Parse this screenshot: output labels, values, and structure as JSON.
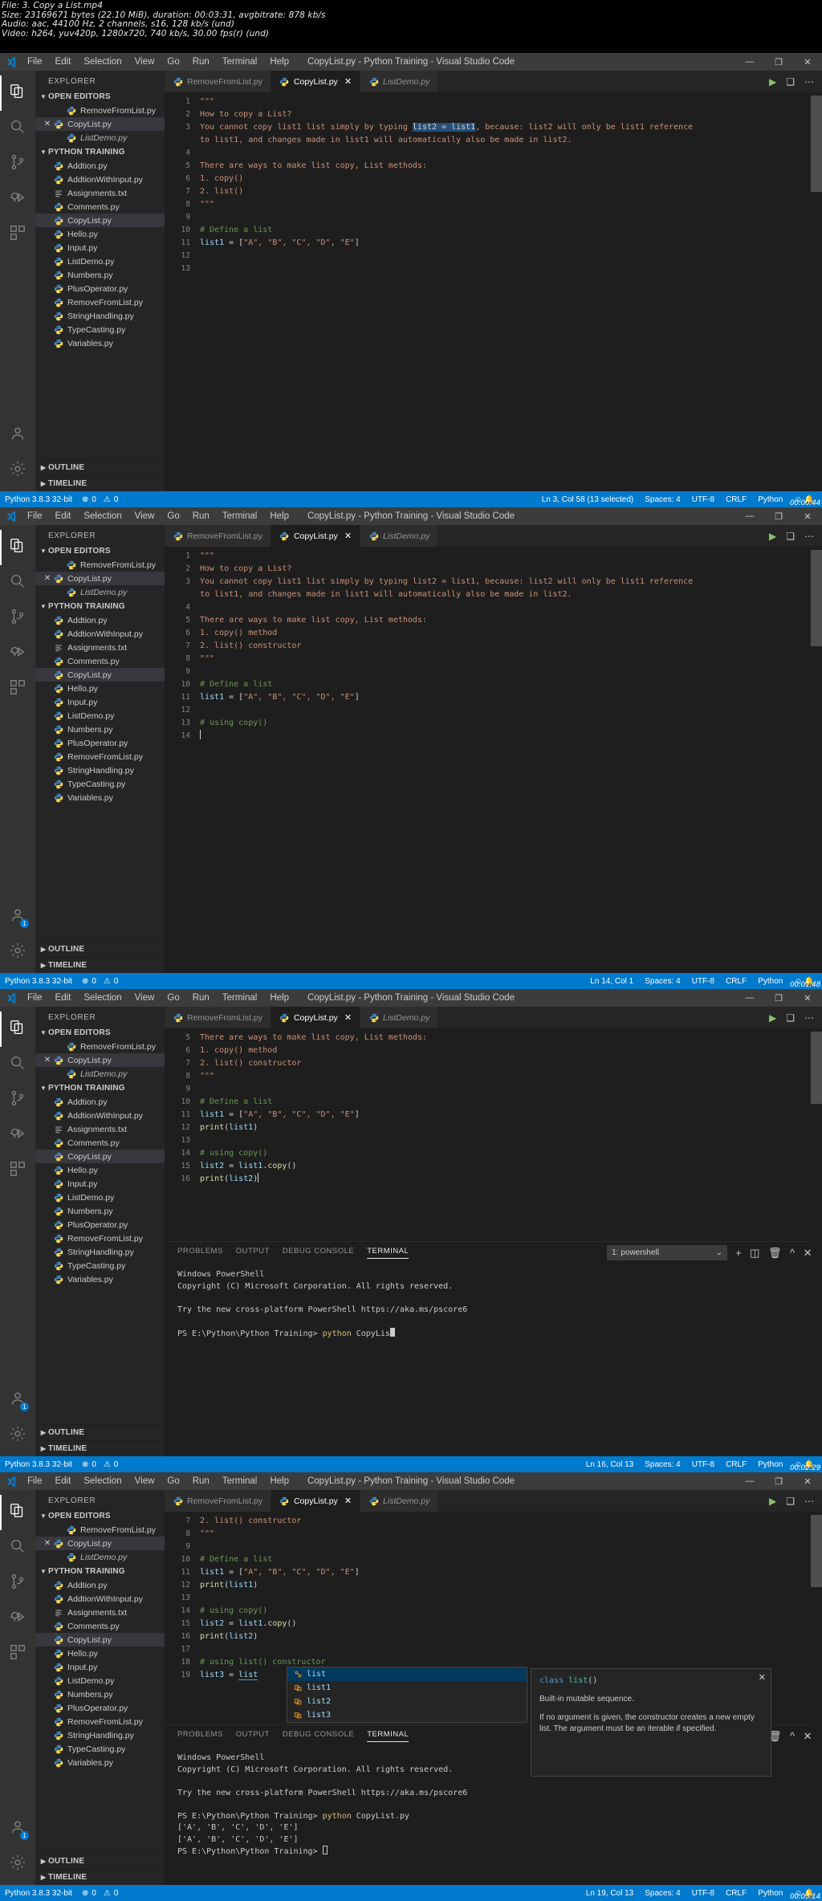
{
  "meta": {
    "lines": [
      "File: 3. Copy a List.mp4",
      "Size: 23169671 bytes (22.10 MiB), duration: 00:03:31, avgbitrate: 878 kb/s",
      "Audio: aac, 44100 Hz, 2 channels, s16, 128 kb/s (und)",
      "Video: h264, yuv420p, 1280x720, 740 kb/s, 30.00 fps(r) (und)"
    ]
  },
  "menu": [
    "File",
    "Edit",
    "Selection",
    "View",
    "Go",
    "Run",
    "Terminal",
    "Help"
  ],
  "window_title": "CopyList.py - Python Training - Visual Studio Code",
  "window_controls": [
    "—",
    "❐",
    "✕"
  ],
  "activity_bar": [
    {
      "name": "explorer",
      "label": "Explorer"
    },
    {
      "name": "search",
      "label": "Search"
    },
    {
      "name": "source-control",
      "label": "Source Control"
    },
    {
      "name": "run-debug",
      "label": "Run and Debug"
    },
    {
      "name": "extensions",
      "label": "Extensions"
    }
  ],
  "sidebar": {
    "title": "EXPLORER",
    "open_editors_label": "OPEN EDITORS",
    "open_editors": [
      {
        "label": "RemoveFromList.py",
        "state": "normal"
      },
      {
        "label": "CopyList.py",
        "state": "active"
      },
      {
        "label": "ListDemo.py",
        "state": "preview"
      }
    ],
    "project_label": "PYTHON TRAINING",
    "files": [
      "Addtion.py",
      "AddtionWithInput.py",
      "Assignments.txt",
      "Comments.py",
      "CopyList.py",
      "Hello.py",
      "Input.py",
      "ListDemo.py",
      "Numbers.py",
      "PlusOperator.py",
      "RemoveFromList.py",
      "StringHandling.py",
      "TypeCasting.py",
      "Variables.py"
    ],
    "selected_file": "CopyList.py",
    "outline_label": "OUTLINE",
    "timeline_label": "TIMELINE"
  },
  "tabs": [
    {
      "label": "RemoveFromList.py",
      "active": false,
      "preview": false
    },
    {
      "label": "CopyList.py",
      "active": true,
      "preview": false,
      "close": "✕"
    },
    {
      "label": "ListDemo.py",
      "active": false,
      "preview": true
    }
  ],
  "editor_actions": {
    "run": "▶",
    "split": "❑",
    "more": "⋯"
  },
  "panel": {
    "tabs": [
      "PROBLEMS",
      "OUTPUT",
      "DEBUG CONSOLE",
      "TERMINAL"
    ],
    "active_tab": "TERMINAL",
    "terminal_select": "1: powershell",
    "select_caret": "⌄",
    "actions": [
      "+",
      "◫",
      "Ὕ1",
      "^",
      "✕"
    ]
  },
  "windows": [
    {
      "id": "w1",
      "code": [
        {
          "n": "1",
          "segs": [
            {
              "t": "\"\"\"",
              "c": "str"
            }
          ]
        },
        {
          "n": "2",
          "segs": [
            {
              "t": "How to copy a List?",
              "c": "str"
            }
          ]
        },
        {
          "n": "3",
          "segs": [
            {
              "t": "You cannot copy list1 list simply by typing ",
              "c": "str"
            },
            {
              "t": "list2 = list1",
              "c": "sel"
            },
            {
              "t": ", because: list2 will only be list1 reference",
              "c": "str"
            }
          ]
        },
        {
          "n": "",
          "segs": [
            {
              "t": "to list1, and changes made in list1 will automatically also be made in list2.",
              "c": "str"
            }
          ]
        },
        {
          "n": "4",
          "segs": []
        },
        {
          "n": "5",
          "segs": [
            {
              "t": "There are ways to make list copy, List methods:",
              "c": "str"
            }
          ]
        },
        {
          "n": "6",
          "segs": [
            {
              "t": "1. copy()",
              "c": "str"
            }
          ]
        },
        {
          "n": "7",
          "segs": [
            {
              "t": "2. list()",
              "c": "str"
            }
          ]
        },
        {
          "n": "8",
          "segs": [
            {
              "t": "\"\"\"",
              "c": "str"
            }
          ]
        },
        {
          "n": "9",
          "segs": []
        },
        {
          "n": "10",
          "segs": [
            {
              "t": "# Define a list",
              "c": "cmt"
            }
          ]
        },
        {
          "n": "11",
          "segs": [
            {
              "t": "list1 ",
              "c": "var"
            },
            {
              "t": "= ",
              "c": "plain"
            },
            {
              "t": "[",
              "c": "plain"
            },
            {
              "t": "\"A\", \"B\", \"C\", \"D\", \"E\"",
              "c": "str"
            },
            {
              "t": "]",
              "c": "plain"
            }
          ]
        },
        {
          "n": "12",
          "segs": []
        },
        {
          "n": "13",
          "segs": []
        }
      ],
      "status": {
        "python": "Python 3.8.3 32-bit",
        "errors": "0",
        "warnings": "0",
        "position": "Ln 3, Col 58 (13 selected)",
        "spaces": "Spaces: 4",
        "encoding": "UTF-8",
        "eol": "CRLF",
        "language": "Python",
        "timecode": "00:00:44"
      }
    },
    {
      "id": "w2",
      "code": [
        {
          "n": "1",
          "segs": [
            {
              "t": "\"\"\"",
              "c": "str"
            }
          ]
        },
        {
          "n": "2",
          "segs": [
            {
              "t": "How to copy a List?",
              "c": "str"
            }
          ]
        },
        {
          "n": "3",
          "segs": [
            {
              "t": "You cannot copy list1 list simply by typing list2 = list1, because: list2 will only be list1 reference",
              "c": "str"
            }
          ]
        },
        {
          "n": "",
          "segs": [
            {
              "t": "to list1, and changes made in list1 will automatically also be made in list2.",
              "c": "str"
            }
          ]
        },
        {
          "n": "4",
          "segs": []
        },
        {
          "n": "5",
          "segs": [
            {
              "t": "There are ways to make list copy, List methods:",
              "c": "str"
            }
          ]
        },
        {
          "n": "6",
          "segs": [
            {
              "t": "1. copy() method",
              "c": "str"
            }
          ]
        },
        {
          "n": "7",
          "segs": [
            {
              "t": "2. list() constructor",
              "c": "str"
            }
          ]
        },
        {
          "n": "8",
          "segs": [
            {
              "t": "\"\"\"",
              "c": "str"
            }
          ]
        },
        {
          "n": "9",
          "segs": []
        },
        {
          "n": "10",
          "segs": [
            {
              "t": "# Define a list",
              "c": "cmt"
            }
          ]
        },
        {
          "n": "11",
          "segs": [
            {
              "t": "list1 ",
              "c": "var"
            },
            {
              "t": "= ",
              "c": "plain"
            },
            {
              "t": "[",
              "c": "plain"
            },
            {
              "t": "\"A\", \"B\", \"C\", \"D\", \"E\"",
              "c": "str"
            },
            {
              "t": "]",
              "c": "plain"
            }
          ]
        },
        {
          "n": "12",
          "segs": []
        },
        {
          "n": "13",
          "segs": [
            {
              "t": "# using copy()",
              "c": "cmt"
            }
          ]
        },
        {
          "n": "14",
          "segs": [
            {
              "t": "",
              "c": "caret"
            }
          ]
        }
      ],
      "status": {
        "python": "Python 3.8.3 32-bit",
        "errors": "0",
        "warnings": "0",
        "position": "Ln 14, Col 1",
        "spaces": "Spaces: 4",
        "encoding": "UTF-8",
        "eol": "CRLF",
        "language": "Python",
        "timecode": "00:01:48"
      }
    },
    {
      "id": "w3",
      "code": [
        {
          "n": "5",
          "segs": [
            {
              "t": "There are ways to make list copy, List methods:",
              "c": "str"
            }
          ]
        },
        {
          "n": "6",
          "segs": [
            {
              "t": "1. copy() method",
              "c": "str"
            }
          ]
        },
        {
          "n": "7",
          "segs": [
            {
              "t": "2. list() constructor",
              "c": "str"
            }
          ]
        },
        {
          "n": "8",
          "segs": [
            {
              "t": "\"\"\"",
              "c": "str"
            }
          ]
        },
        {
          "n": "9",
          "segs": []
        },
        {
          "n": "10",
          "segs": [
            {
              "t": "# Define a list",
              "c": "cmt"
            }
          ]
        },
        {
          "n": "11",
          "segs": [
            {
              "t": "list1 ",
              "c": "var"
            },
            {
              "t": "= ",
              "c": "plain"
            },
            {
              "t": "[",
              "c": "plain"
            },
            {
              "t": "\"A\", \"B\", \"C\", \"D\", \"E\"",
              "c": "str"
            },
            {
              "t": "]",
              "c": "plain"
            }
          ]
        },
        {
          "n": "12",
          "segs": [
            {
              "t": "print",
              "c": "fn"
            },
            {
              "t": "(",
              "c": "plain"
            },
            {
              "t": "list1",
              "c": "var"
            },
            {
              "t": ")",
              "c": "plain"
            }
          ]
        },
        {
          "n": "13",
          "segs": []
        },
        {
          "n": "14",
          "segs": [
            {
              "t": "# using copy()",
              "c": "cmt"
            }
          ]
        },
        {
          "n": "15",
          "segs": [
            {
              "t": "list2 ",
              "c": "var"
            },
            {
              "t": "= ",
              "c": "plain"
            },
            {
              "t": "list1",
              "c": "var"
            },
            {
              "t": ".",
              "c": "plain"
            },
            {
              "t": "copy",
              "c": "fn"
            },
            {
              "t": "()",
              "c": "plain"
            }
          ]
        },
        {
          "n": "16",
          "segs": [
            {
              "t": "print",
              "c": "fn"
            },
            {
              "t": "(",
              "c": "plain"
            },
            {
              "t": "list2",
              "c": "var"
            },
            {
              "t": ")",
              "c": "caretafter"
            }
          ]
        }
      ],
      "terminal": [
        {
          "segs": [
            {
              "t": "Windows PowerShell",
              "c": "plain"
            }
          ]
        },
        {
          "segs": [
            {
              "t": "Copyright (C) Microsoft Corporation. All rights reserved.",
              "c": "plain"
            }
          ]
        },
        {
          "segs": []
        },
        {
          "segs": [
            {
              "t": "Try the new cross-platform PowerShell https://aka.ms/pscore6",
              "c": "plain"
            }
          ]
        },
        {
          "segs": []
        },
        {
          "segs": [
            {
              "t": "PS E:\\Python\\Python Training> ",
              "c": "plain"
            },
            {
              "t": "python",
              "c": "tyellow"
            },
            {
              "t": " CopyLis",
              "c": "plain"
            },
            {
              "t": "█",
              "c": "block"
            }
          ]
        }
      ],
      "status": {
        "python": "Python 3.8.3 32-bit",
        "errors": "0",
        "warnings": "0",
        "position": "Ln 16, Col 13",
        "spaces": "Spaces: 4",
        "encoding": "UTF-8",
        "eol": "CRLF",
        "language": "Python",
        "timecode": "00:02:29"
      }
    },
    {
      "id": "w4",
      "code": [
        {
          "n": "7",
          "segs": [
            {
              "t": "2. list() constructor",
              "c": "str"
            }
          ]
        },
        {
          "n": "8",
          "segs": [
            {
              "t": "\"\"\"",
              "c": "str"
            }
          ]
        },
        {
          "n": "9",
          "segs": []
        },
        {
          "n": "10",
          "segs": [
            {
              "t": "# Define a list",
              "c": "cmt"
            }
          ]
        },
        {
          "n": "11",
          "segs": [
            {
              "t": "list1 ",
              "c": "var"
            },
            {
              "t": "= ",
              "c": "plain"
            },
            {
              "t": "[",
              "c": "plain"
            },
            {
              "t": "\"A\", \"B\", \"C\", \"D\", \"E\"",
              "c": "str"
            },
            {
              "t": "]",
              "c": "plain"
            }
          ]
        },
        {
          "n": "12",
          "segs": [
            {
              "t": "print",
              "c": "fn"
            },
            {
              "t": "(",
              "c": "plain"
            },
            {
              "t": "list1",
              "c": "var"
            },
            {
              "t": ")",
              "c": "plain"
            }
          ]
        },
        {
          "n": "13",
          "segs": []
        },
        {
          "n": "14",
          "segs": [
            {
              "t": "# using copy()",
              "c": "cmt"
            }
          ]
        },
        {
          "n": "15",
          "segs": [
            {
              "t": "list2 ",
              "c": "var"
            },
            {
              "t": "= ",
              "c": "plain"
            },
            {
              "t": "list1",
              "c": "var"
            },
            {
              "t": ".",
              "c": "plain"
            },
            {
              "t": "copy",
              "c": "fn"
            },
            {
              "t": "()",
              "c": "plain"
            }
          ]
        },
        {
          "n": "16",
          "segs": [
            {
              "t": "print",
              "c": "fn"
            },
            {
              "t": "(",
              "c": "plain"
            },
            {
              "t": "list2",
              "c": "var"
            },
            {
              "t": ")",
              "c": "plain"
            }
          ]
        },
        {
          "n": "17",
          "segs": []
        },
        {
          "n": "18",
          "segs": [
            {
              "t": "# using list() constructor",
              "c": "cmt"
            }
          ]
        },
        {
          "n": "19",
          "segs": [
            {
              "t": "list3 ",
              "c": "var"
            },
            {
              "t": "= ",
              "c": "plain"
            },
            {
              "t": "list",
              "c": "under"
            }
          ]
        }
      ],
      "suggest": {
        "items": [
          {
            "label": "list",
            "kind": "class",
            "selected": true
          },
          {
            "label": "list1",
            "kind": "variable",
            "selected": false
          },
          {
            "label": "list2",
            "kind": "variable",
            "selected": false
          },
          {
            "label": "list3",
            "kind": "variable",
            "selected": false
          }
        ]
      },
      "doc": {
        "signature_kw": "class",
        "signature_name": "list",
        "signature_args": "()",
        "paragraphs": [
          "Built-in mutable sequence.",
          "If no argument is given, the constructor creates a new empty list. The argument must be an iterable if specified."
        ],
        "close": "✕"
      },
      "terminal": [
        {
          "segs": [
            {
              "t": "Windows PowerShell",
              "c": "plain"
            }
          ]
        },
        {
          "segs": [
            {
              "t": "Copyright (C) Microsoft Corporation. All rights reserved.",
              "c": "plain"
            }
          ]
        },
        {
          "segs": []
        },
        {
          "segs": [
            {
              "t": "Try the new cross-platform PowerShell https://aka.ms/pscore6",
              "c": "plain"
            }
          ]
        },
        {
          "segs": []
        },
        {
          "segs": [
            {
              "t": "PS E:\\Python\\Python Training> ",
              "c": "plain"
            },
            {
              "t": "python",
              "c": "tyellow"
            },
            {
              "t": " CopyList.py",
              "c": "plain"
            }
          ]
        },
        {
          "segs": [
            {
              "t": "['A', 'B', 'C', 'D', 'E']",
              "c": "plain"
            }
          ]
        },
        {
          "segs": [
            {
              "t": "['A', 'B', 'C', 'D', 'E']",
              "c": "plain"
            }
          ]
        },
        {
          "segs": [
            {
              "t": "PS E:\\Python\\Python Training> ",
              "c": "plain"
            },
            {
              "t": "⎕",
              "c": "hollow"
            }
          ]
        }
      ],
      "status": {
        "python": "Python 3.8.3 32-bit",
        "errors": "0",
        "warnings": "0",
        "position": "Ln 19, Col 13",
        "spaces": "Spaces: 4",
        "encoding": "UTF-8",
        "eol": "CRLF",
        "language": "Python",
        "timecode": "00:03:14"
      }
    }
  ]
}
